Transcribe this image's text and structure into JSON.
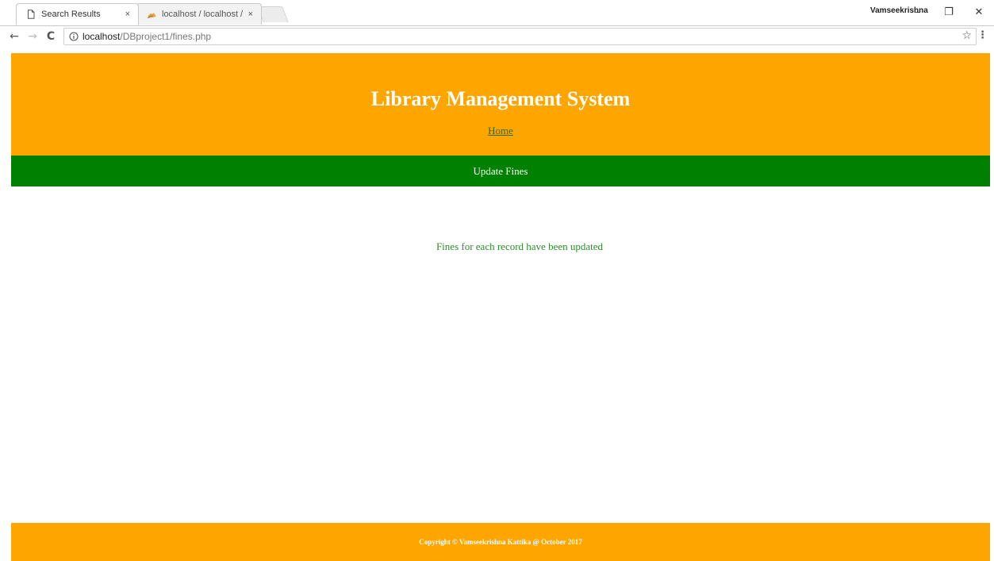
{
  "browser": {
    "tabs": [
      {
        "title": "Search Results",
        "active": true,
        "icon": "page-icon"
      },
      {
        "title": "localhost / localhost / lib",
        "active": false,
        "icon": "phpmyadmin-icon"
      }
    ],
    "close_glyph": "×",
    "profile_name": "Vamseekrishna",
    "window_controls": {
      "minimize": "–",
      "restore": "❐",
      "close": "✕"
    },
    "nav": {
      "back": "←",
      "forward": "→",
      "reload": "C"
    },
    "url": {
      "host": "localhost",
      "path": "/DBproject1/fines.php"
    },
    "bookmark_glyph": "☆",
    "menu_glyph": "⋮"
  },
  "header": {
    "title": "Library Management System",
    "home_link": "Home"
  },
  "nav_bar": {
    "label": "Update Fines"
  },
  "main": {
    "message": "Fines for each record have been updated"
  },
  "footer": {
    "text": "Copyright © Vamseekrishna Kattika @ October 2017"
  },
  "colors": {
    "header_bg": "#ffa500",
    "nav_bar_bg": "#008000",
    "footer_bg": "#ffa500",
    "message_text": "#2e8b2e",
    "link_text": "#2e6b1e"
  }
}
